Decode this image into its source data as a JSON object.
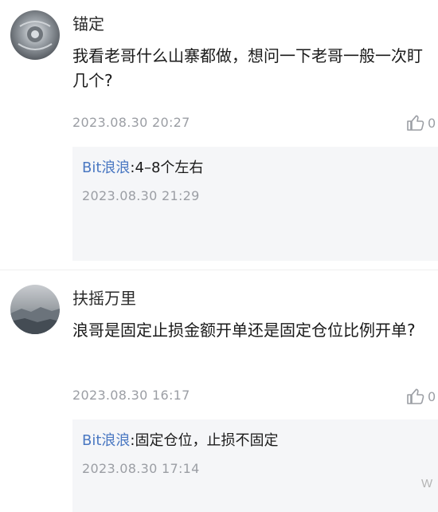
{
  "comments": [
    {
      "username": "锚定",
      "content": "我看老哥什么山寨都做，想问一下老哥一般一次盯几个?",
      "time": "2023.08.30 20:27",
      "likes": "0",
      "reply": {
        "author": "Bit浪浪",
        "separator": ":",
        "text": "4–8个左右",
        "time": "2023.08.30 21:29"
      }
    },
    {
      "username": "扶摇万里",
      "content": "浪哥是固定止损金额开单还是固定仓位比例开单?",
      "time": "2023.08.30 16:17",
      "likes": "0",
      "reply": {
        "author": "Bit浪浪",
        "separator": ":",
        "text": "固定仓位，止损不固定",
        "time": "2023.08.30 17:14"
      }
    }
  ],
  "icons": {
    "like": "thumbs-up-icon"
  },
  "colors": {
    "reply_author": "#4a78c2",
    "muted": "#9b9ea4",
    "reply_bg": "#f5f6f8"
  }
}
